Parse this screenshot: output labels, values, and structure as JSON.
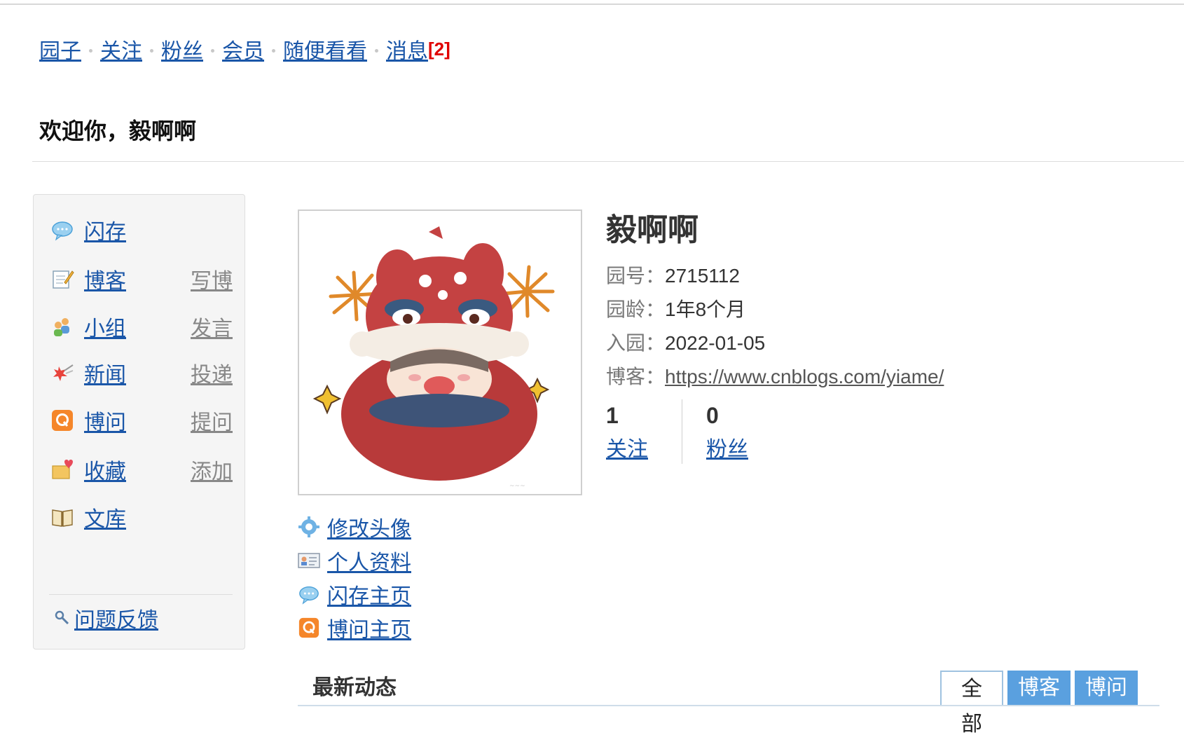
{
  "top_nav": {
    "items": [
      "园子",
      "关注",
      "粉丝",
      "会员",
      "随便看看",
      "消息"
    ],
    "message_count": "[2]"
  },
  "welcome": "欢迎你，毅啊啊",
  "sidebar": {
    "items": [
      {
        "label": "闪存",
        "sub": "",
        "icon": "chat-bubble-icon"
      },
      {
        "label": "博客",
        "sub": "写博",
        "icon": "notepad-pencil-icon"
      },
      {
        "label": "小组",
        "sub": "发言",
        "icon": "group-people-icon"
      },
      {
        "label": "新闻",
        "sub": "投递",
        "icon": "news-burst-icon"
      },
      {
        "label": "博问",
        "sub": "提问",
        "icon": "q-badge-icon"
      },
      {
        "label": "收藏",
        "sub": "添加",
        "icon": "heart-folder-icon"
      },
      {
        "label": "文库",
        "sub": "",
        "icon": "open-book-icon"
      }
    ],
    "feedback": "问题反馈"
  },
  "avatar_actions": [
    {
      "label": "修改头像",
      "icon": "gear-icon"
    },
    {
      "label": "个人资料",
      "icon": "id-card-icon"
    },
    {
      "label": "闪存主页",
      "icon": "chat-bubble-icon"
    },
    {
      "label": "博问主页",
      "icon": "q-badge-icon"
    }
  ],
  "profile": {
    "name": "毅啊啊",
    "id_label": "园号：",
    "id_value": "2715112",
    "age_label": "园龄：",
    "age_value": "1年8个月",
    "joined_label": "入园：",
    "joined_value": "2022-01-05",
    "blog_label": "博客：",
    "blog_url": "https://www.cnblogs.com/yiame/"
  },
  "stats": {
    "following_count": "1",
    "following_label": "关注",
    "followers_count": "0",
    "followers_label": "粉丝"
  },
  "activity": {
    "title": "最新动态",
    "tabs": [
      "全部",
      "博客",
      "博问"
    ]
  },
  "colors": {
    "link": "#1a56a8",
    "badge_red": "#e00000",
    "tab_blue": "#5aa0df"
  }
}
